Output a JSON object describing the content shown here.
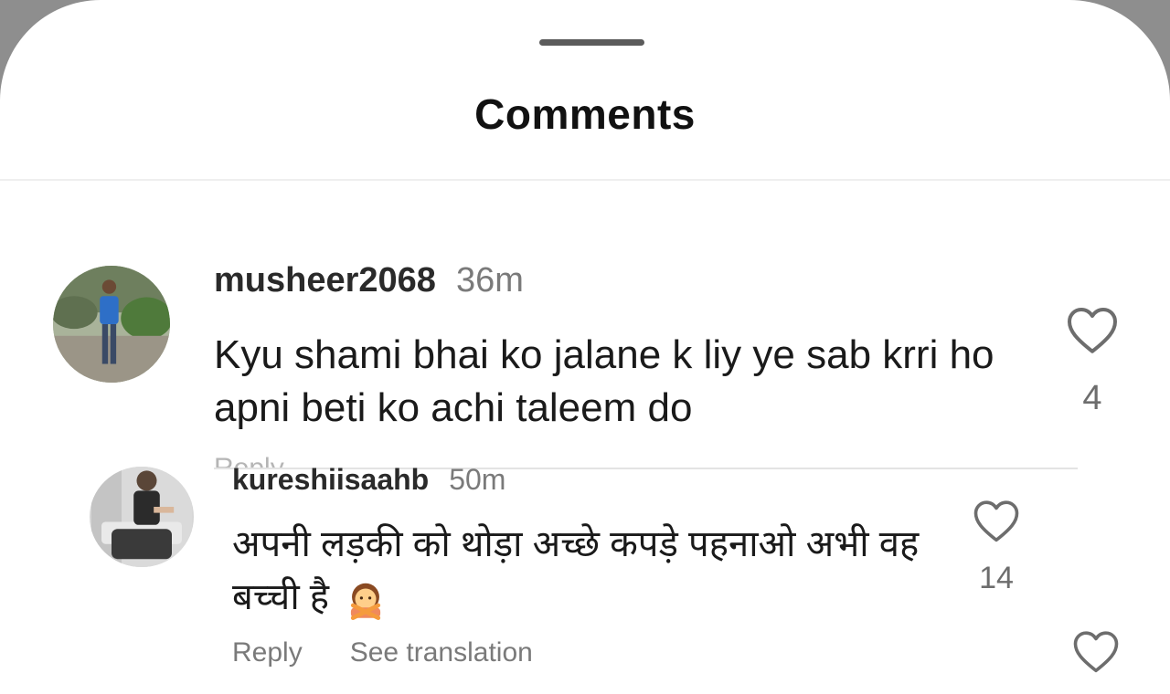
{
  "header": {
    "title": "Comments"
  },
  "comments": [
    {
      "username": "musheer2068",
      "time": "36m",
      "text": "Kyu shami bhai ko jalane k liy ye sab krri ho apni beti ko achi taleem do",
      "likes": "4"
    },
    {
      "username": "kureshiisaahb",
      "time": "50m",
      "text": "अपनी लड़की को थोड़ा अच्छे कपड़े पहनाओ अभी वह बच्ची है",
      "emoji": "woman-gesturing-no-emoji",
      "likes": "14",
      "reply_label": "Reply",
      "translate_label": "See translation"
    }
  ],
  "icons": {
    "like": "heart-outline-icon"
  },
  "colors": {
    "text": "#111111",
    "secondary": "#7a7a7a",
    "background": "#ffffff"
  }
}
